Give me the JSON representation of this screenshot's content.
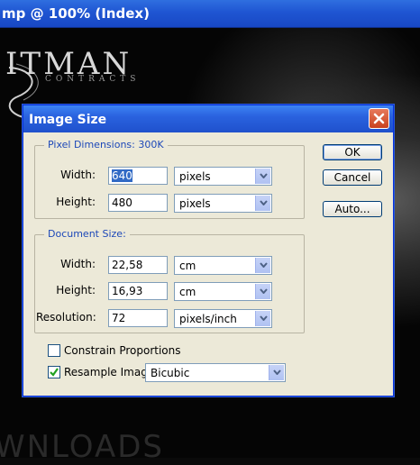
{
  "window": {
    "title": "mp @ 100% (Index)"
  },
  "background": {
    "logo_text": "ITMAN",
    "logo_sub": "CONTRACTS",
    "footer_text": "WNLOADS"
  },
  "dialog": {
    "title": "Image Size",
    "pixel_dimensions": {
      "label": "Pixel Dimensions:",
      "size": "300K",
      "width_label": "Width:",
      "width_value": "640",
      "width_unit": "pixels",
      "height_label": "Height:",
      "height_value": "480",
      "height_unit": "pixels"
    },
    "document_size": {
      "label": "Document Size:",
      "width_label": "Width:",
      "width_value": "22,58",
      "width_unit": "cm",
      "height_label": "Height:",
      "height_value": "16,93",
      "height_unit": "cm",
      "resolution_label": "Resolution:",
      "resolution_value": "72",
      "resolution_unit": "pixels/inch"
    },
    "constrain_label": "Constrain Proportions",
    "constrain_checked": false,
    "resample_label": "Resample Image:",
    "resample_checked": true,
    "resample_value": "Bicubic",
    "buttons": {
      "ok": "OK",
      "cancel": "Cancel",
      "auto": "Auto..."
    }
  }
}
